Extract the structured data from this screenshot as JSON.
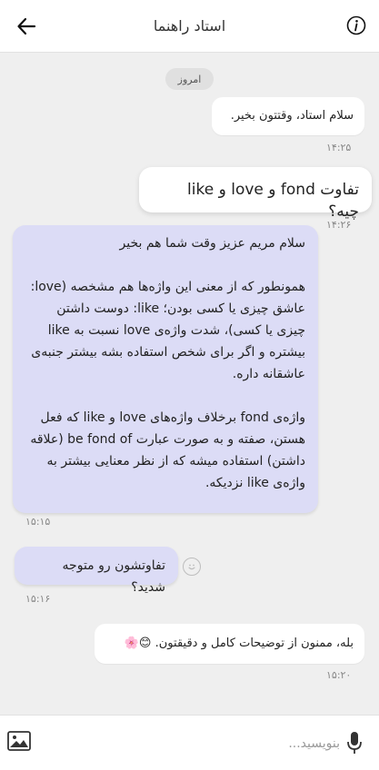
{
  "header": {
    "title": "استاد راهنما",
    "back_icon": "arrow-left-icon",
    "info_icon": "info-icon"
  },
  "chat": {
    "date_label": "امروز",
    "messages": [
      {
        "text": "سلام استاد، وقتتون بخیر.",
        "time": "۱۴:۲۵"
      },
      {
        "text": "تفاوت fond و love و like چیه؟",
        "time": "۱۴:۲۶"
      },
      {
        "paragraphs": [
          "سلام مریم عزیز وقت شما هم بخیر",
          "همونطور که از معنی این واژه‌ها هم مشخصه (love: عاشق چیزی یا کسی بودن؛ like: دوست داشتن چیزی یا کسی)، شدت واژه‌ی love نسبت به like بیشتره و اگر برای شخص استفاده بشه بیشتر جنبه‌ی عاشقانه داره.",
          "واژه‌ی fond برخلاف واژه‌های love و like که فعل هستن، صفته و به صورت عبارت be fond of (علاقه داشتن) استفاده میشه که از نظر معنایی بیشتر به واژه‌ی like نزدیکه."
        ],
        "time": "۱۵:۱۵"
      },
      {
        "text": "تفاوتشون رو متوجه شدید؟",
        "time": "۱۵:۱۶"
      },
      {
        "text": "بله، ممنون از توضیحات کامل و دقیقتون. 😊🌸",
        "time": "۱۵:۲۰"
      }
    ]
  },
  "composer": {
    "placeholder": "بنویسید..."
  },
  "colors": {
    "background": "#efefef",
    "incoming_bubble": "#dcdcf6",
    "outgoing_bubble": "#ffffff"
  }
}
